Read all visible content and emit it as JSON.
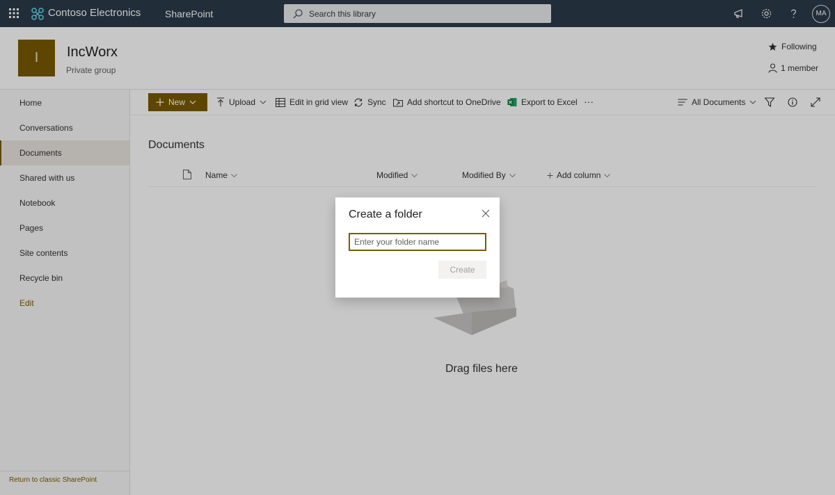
{
  "suite": {
    "brand": "Contoso Electronics",
    "app": "SharePoint",
    "search_placeholder": "Search this library",
    "avatar_initials": "MA"
  },
  "site": {
    "logo_letter": "I",
    "title": "IncWorx",
    "subtitle": "Private group",
    "following": "Following",
    "members": "1 member"
  },
  "nav": {
    "items": [
      "Home",
      "Conversations",
      "Documents",
      "Shared with us",
      "Notebook",
      "Pages",
      "Site contents",
      "Recycle bin"
    ],
    "edit": "Edit",
    "classic": "Return to classic SharePoint"
  },
  "commands": {
    "new": "New",
    "upload": "Upload",
    "grid": "Edit in grid view",
    "sync": "Sync",
    "shortcut": "Add shortcut to OneDrive",
    "excel": "Export to Excel",
    "more": "···",
    "view": "All Documents"
  },
  "library": {
    "title": "Documents",
    "columns": [
      "Name",
      "Modified",
      "Modified By",
      "Add column"
    ],
    "empty_text": "Drag files here"
  },
  "dialog": {
    "title": "Create a folder",
    "placeholder": "Enter your folder name",
    "create": "Create"
  },
  "colors": {
    "accent": "#7a5a00",
    "suitebar": "#2b3a4a"
  }
}
